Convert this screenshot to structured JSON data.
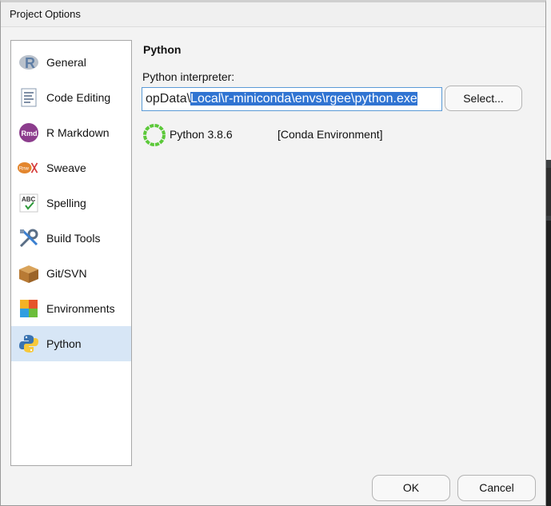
{
  "window": {
    "title": "Project Options"
  },
  "sidebar": {
    "items": [
      {
        "label": "General",
        "icon": "r-logo-icon"
      },
      {
        "label": "Code Editing",
        "icon": "document-icon"
      },
      {
        "label": "R Markdown",
        "icon": "rmd-icon"
      },
      {
        "label": "Sweave",
        "icon": "sweave-icon"
      },
      {
        "label": "Spelling",
        "icon": "spelling-abc-icon"
      },
      {
        "label": "Build Tools",
        "icon": "tools-icon"
      },
      {
        "label": "Git/SVN",
        "icon": "box-icon"
      },
      {
        "label": "Environments",
        "icon": "environments-icon"
      },
      {
        "label": "Python",
        "icon": "python-icon",
        "selected": true
      }
    ]
  },
  "main": {
    "section_title": "Python",
    "interpreter_label": "Python interpreter:",
    "interpreter_path_unselected": "opData\\",
    "interpreter_path_selected": "Local\\r-miniconda\\envs\\rgee\\python.exe",
    "select_button": "Select...",
    "python_version": "Python 3.8.6",
    "environment_type": "[Conda Environment]"
  },
  "footer": {
    "ok": "OK",
    "cancel": "Cancel"
  },
  "colors": {
    "selected_bg": "#d7e6f6",
    "text_selection": "#3074d2",
    "accent_ring": "#5cc93a"
  }
}
